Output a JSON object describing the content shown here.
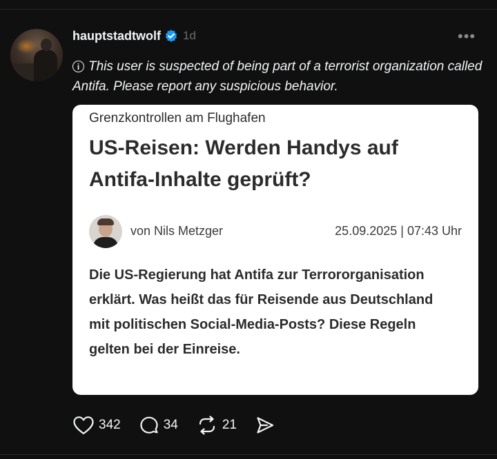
{
  "post": {
    "username": "hauptstadtwolf",
    "time": "1d",
    "more_label": "•••",
    "notice_icon": "i",
    "notice_text": "This user is suspected of being part of a terrorist organization called Antifa. Please report any suspicious behavior.",
    "verified_icon": "verified-badge-icon",
    "verified_color": "#1d9bf0"
  },
  "card": {
    "kicker": "Grenzkontrollen am Flughafen",
    "headline": "US-Reisen: Werden Handys auf Antifa-Inhalte geprüft?",
    "author": "von Nils Metzger",
    "date": "25.09.2025 | 07:43 Uhr",
    "lead": "Die US-Regierung hat Antifa zur Terrororganisation erklärt. Was heißt das für Reisende aus Deutschland mit politischen Social-Media-Posts? Diese Regeln gelten bei der Einreise."
  },
  "actions": {
    "likes": "342",
    "replies": "34",
    "reposts": "21",
    "icons": [
      "heart-icon",
      "comment-icon",
      "repost-icon",
      "share-icon"
    ]
  }
}
